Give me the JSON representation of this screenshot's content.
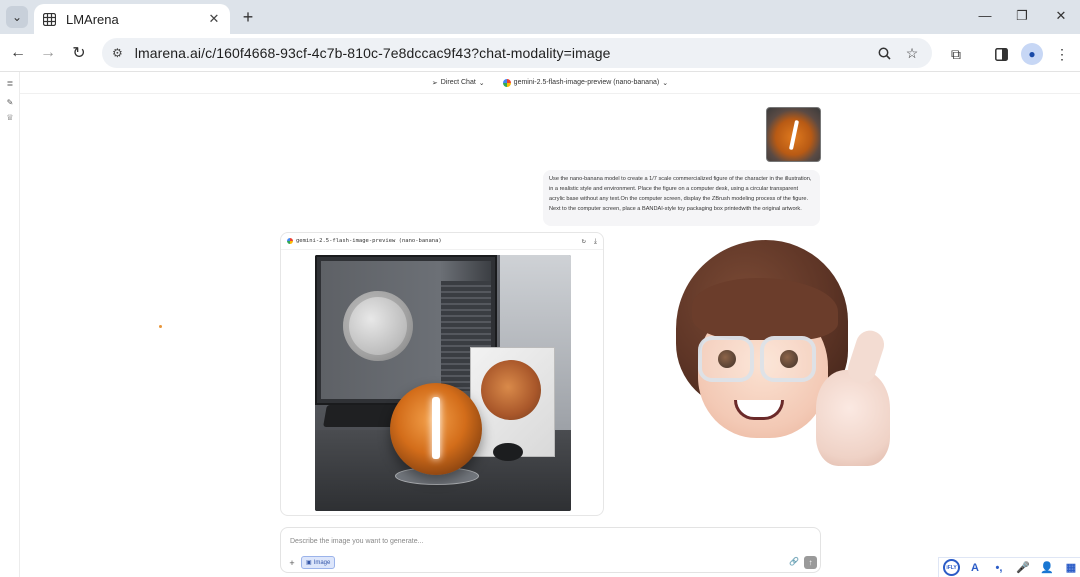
{
  "browser": {
    "tab_title": "LMArena",
    "tab_close": "✕",
    "new_tab": "+",
    "url": "lmarena.ai/c/160f4668-93cf-4c7b-810c-7e8dccac9f43?chat-modality=image",
    "window_controls": {
      "minimize": "—",
      "restore": "❐",
      "close": "✕"
    }
  },
  "topbar": {
    "mode_label": "Direct Chat",
    "model_label": "gemini-2.5-flash-image-preview (nano-banana)"
  },
  "prompt": {
    "text": "Use the nano-banana model to create a 1/7 scale commercialized figure of the character in the illustration, in a realistic style and environment. Place the figure on a computer desk, using a circular transparent acrylic base without any text.On the computer screen, display the ZBrush modeling process of the figure. Next to the computer screen, place a BANDAI-style toy packaging box printedwith the original artwork."
  },
  "response": {
    "model_name": "gemini-2.5-flash-image-preview (nano-banana)"
  },
  "composer": {
    "placeholder": "Describe the image you want to generate...",
    "image_button_label": "Image"
  },
  "ime": {
    "logo": "iFLY",
    "items": [
      "A",
      "•,",
      "🎤",
      "👤",
      "▦"
    ]
  },
  "colors": {
    "chrome_bg": "#dde3ea",
    "accent_blue": "#3557a8",
    "ime_blue": "#2b5cc7"
  }
}
